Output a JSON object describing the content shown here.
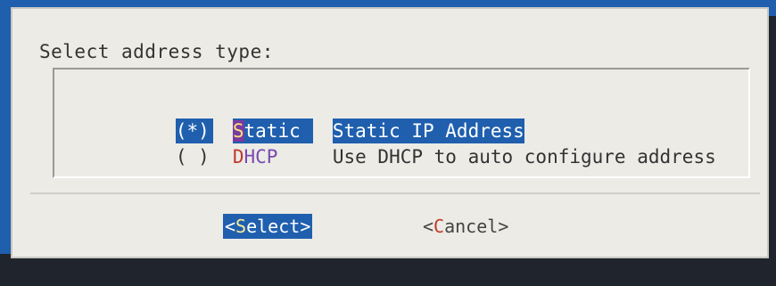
{
  "dialog": {
    "title": "Select address type:",
    "options": [
      {
        "radio": "(*)",
        "tag_hotkey": "S",
        "tag_rest": "tatic",
        "description": "Static IP Address",
        "selected": true
      },
      {
        "radio": "( )",
        "tag_hotkey": "D",
        "tag_rest": "HCP",
        "description": "Use DHCP to auto configure address",
        "selected": false
      }
    ],
    "buttons": {
      "select": {
        "open": "<",
        "hotkey": "S",
        "rest": "elect",
        "close": ">"
      },
      "cancel": {
        "open": "<",
        "hotkey": "C",
        "rest": "ancel",
        "close": ">"
      }
    }
  },
  "colors": {
    "screen_background": "#1f5fae",
    "dialog_background": "#ecebe6",
    "highlight": "#1f5fae",
    "hotkey": "#c0392b"
  }
}
